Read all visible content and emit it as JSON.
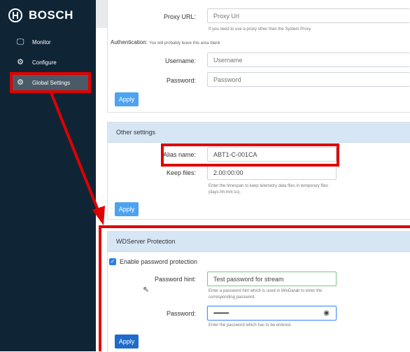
{
  "sidebar": {
    "brand": "BOSCH",
    "items": [
      {
        "label": "Monitor",
        "icon": "monitor-icon"
      },
      {
        "label": "Configure",
        "icon": "gear-icon"
      },
      {
        "label": "Global Settings",
        "icon": "gear-icon"
      }
    ]
  },
  "proxy": {
    "url_label": "Proxy URL:",
    "url_placeholder": "Proxy Url",
    "url_help": "If you need to use a proxy other than the System Proxy",
    "auth_label": "Authentication:",
    "auth_help": "You will probably leave this area blank",
    "username_label": "Username:",
    "username_placeholder": "Username",
    "password_label": "Password:",
    "password_placeholder": "Password",
    "apply": "Apply"
  },
  "other": {
    "title": "Other settings",
    "alias_label": "Alias name:",
    "alias_value": "ABT1-C-001CA",
    "keep_label": "Keep files:",
    "keep_value": "2.00:00:00",
    "keep_help": "Enter the timespan to keep telemetry data files in temporary files (days.hh:mm:ss).",
    "apply": "Apply"
  },
  "wds": {
    "title": "WDServer Protection",
    "enable_label": "Enable password protection",
    "enable_checked": true,
    "hint_label": "Password hint:",
    "hint_value": "Test password for stream",
    "hint_help": "Enter a password hint which is used in WinDarab to enter the corresponding password.",
    "password_label": "Password:",
    "password_value": "••••••••••••",
    "password_help": "Enter the password which has to be entered.",
    "apply": "Apply"
  },
  "colors": {
    "sidebar_bg": "#0f2536",
    "highlight": "#e00000",
    "apply_button": "#4da3ef",
    "panel_header": "#d6e6f5"
  }
}
